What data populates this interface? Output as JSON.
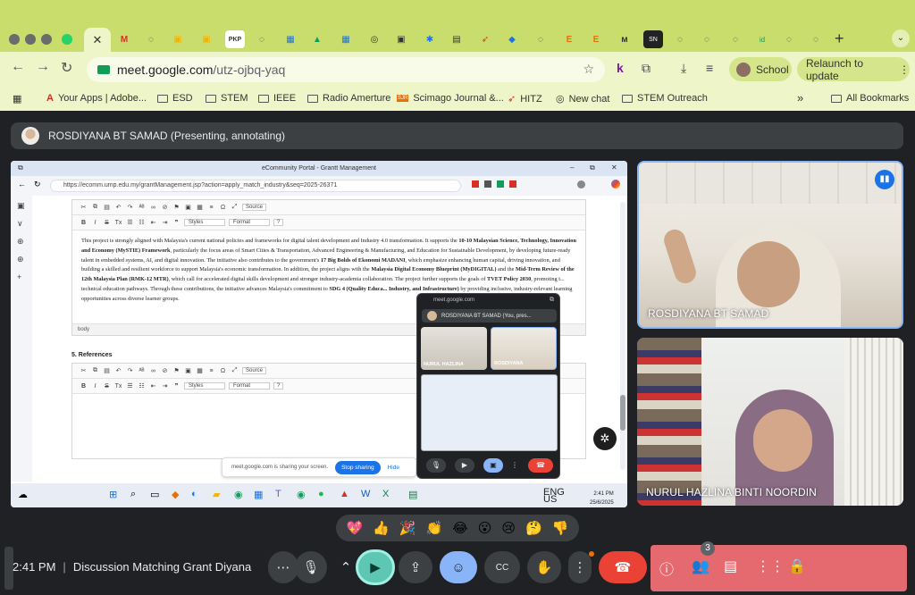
{
  "browser": {
    "url_host": "meet.google.com",
    "url_path": "/utz-ojbq-yaq",
    "profile": "School",
    "relaunch_label": "Relaunch to update",
    "active_tab_close": "✕",
    "new_tab": "+",
    "bookmarks": [
      "Your Apps | Adobe...",
      "ESD",
      "STEM",
      "IEEE",
      "Radio Amerture",
      "Scimago Journal &...",
      "HITZ",
      "New chat",
      "STEM Outreach"
    ],
    "all_bookmarks": "All Bookmarks",
    "more": "»"
  },
  "presenting_banner": "ROSDIYANA BT SAMAD (Presenting, annotating)",
  "shared_screen": {
    "window_title": "eCommunity Portal - Grantt Management",
    "url": "https://ecomm.ump.edu.my/grantManagement.jsp?action=apply_match_industry&seq=2025-26371",
    "toolbar_styles": "Styles",
    "toolbar_format": "Format",
    "toolbar_source": "Source",
    "paragraph_html": "This project is strongly aligned with Malaysia's current national policies and frameworks for digital talent development and Industry 4.0 transformation. It supports the <b>10-10 Malaysian Science, Technology, Innovation and Economy (MySTIE) Framework</b>, particularly the focus areas of Smart Cities &amp; Transportation, Advanced Engineering &amp; Manufacturing, and Education for Sustainable Development, by developing future-ready talent in embedded systems, AI, and digital innovation. The initiative also contributes to the government's <b>17 Big Bolds of Ekonomi MADANI</b>, which emphasize enhancing human capital, driving innovation, and building a skilled and resilient workforce to support Malaysia's economic transformation. In addition, the project aligns with the <b>Malaysia Digital Economy Blueprint (MyDIGITAL)</b> and the <b>Mid-Term Review of the 12th Malaysia Plan (RMK-12 MTR)</b>, which call for accelerated digital skills development and stronger industry-academia collaboration. The project further supports the goals of <b>TVET Policy 2030</b>, promoting t... technical education pathways. Through these contributions, the initiative advances Malaysia's commitment to <b>SDG 4 (Quality Educa...</b> <b>Industry, and Infrastructure)</b> by providing inclusive, industry-relevant learning opportunities across diverse learner groups.",
    "editor_footer": "body",
    "references_heading": "5. References",
    "share_notice": "meet.google.com is sharing your screen.",
    "stop_sharing": "Stop sharing",
    "hide": "Hide",
    "taskbar_lang": "ENG\nUS",
    "taskbar_time": "2:41 PM",
    "taskbar_date": "25/6/2025",
    "mini_url": "meet.google.com",
    "mini_banner": "ROSDIYANA BT SAMAD (You, pres...",
    "mini_tile1": "NURUL HAZLINA",
    "mini_tile2": "ROSDIYANA"
  },
  "participants": [
    {
      "name": "ROSDIYANA BT SAMAD",
      "speaking": true
    },
    {
      "name": "NURUL HAZLINA BINTI NOORDIN",
      "speaking": false
    }
  ],
  "reactions": [
    "💖",
    "👍",
    "🎉",
    "👏",
    "😂",
    "😮",
    "😢",
    "🤔",
    "👎"
  ],
  "bottom": {
    "time": "2:41 PM",
    "separator": "|",
    "meeting_title": "Discussion Matching Grant Diyana",
    "people_count": "3"
  },
  "colors": {
    "chrome_tab_bar": "#c9dd6c",
    "chrome_toolbar": "#eef5c9",
    "meet_bg": "#202124",
    "leave_red": "#ea4335",
    "camera_active": "#5ec7b3",
    "side_panel": "#e46a70"
  }
}
